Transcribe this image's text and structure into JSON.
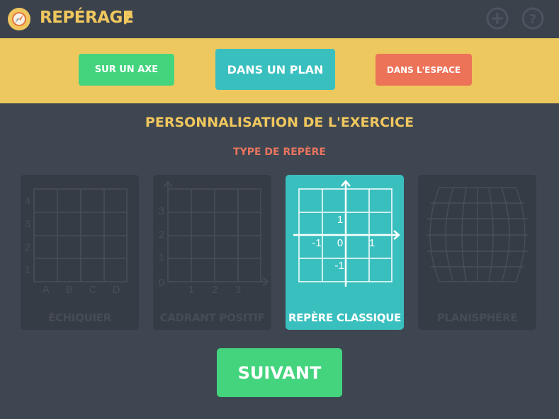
{
  "header": {
    "title": "REPÉRAGE",
    "logo_icon": "compass-icon",
    "add_icon": "plus-circle-icon",
    "help_icon": "question-circle-icon"
  },
  "nav": {
    "tabs": [
      {
        "label": "SUR UN AXE",
        "color": "#44d47e"
      },
      {
        "label": "DANS UN PLAN",
        "color": "#3abfbf",
        "selected": true
      },
      {
        "label": "DANS L'ESPACE",
        "color": "#ec7258"
      }
    ]
  },
  "main": {
    "title": "PERSONNALISATION DE L'EXERCICE",
    "subtitle": "TYPE DE REPÈRE",
    "cards": [
      {
        "label": "ÉCHIQUIER",
        "selected": false,
        "y_ticks": [
          "4",
          "3",
          "2",
          "1"
        ],
        "x_ticks": [
          "A",
          "B",
          "C",
          "D"
        ]
      },
      {
        "label": "CADRANT POSITIF",
        "selected": false,
        "y_ticks": [
          "3",
          "2",
          "1"
        ],
        "x_ticks": [
          "1",
          "2",
          "3"
        ],
        "origin": "0"
      },
      {
        "label": "REPÈRE CLASSIQUE",
        "selected": true,
        "tick_pos_y": "1",
        "tick_neg_x": "-1",
        "origin": "0",
        "tick_pos_x": "1",
        "tick_neg_y": "-1"
      },
      {
        "label": "PLANISPHÈRE",
        "selected": false
      }
    ],
    "next_label": "SUIVANT"
  },
  "colors": {
    "background": "#3e4651",
    "accent_yellow": "#ecc85e",
    "green": "#44d47e",
    "teal": "#3abfbf",
    "orange": "#ec7258"
  }
}
